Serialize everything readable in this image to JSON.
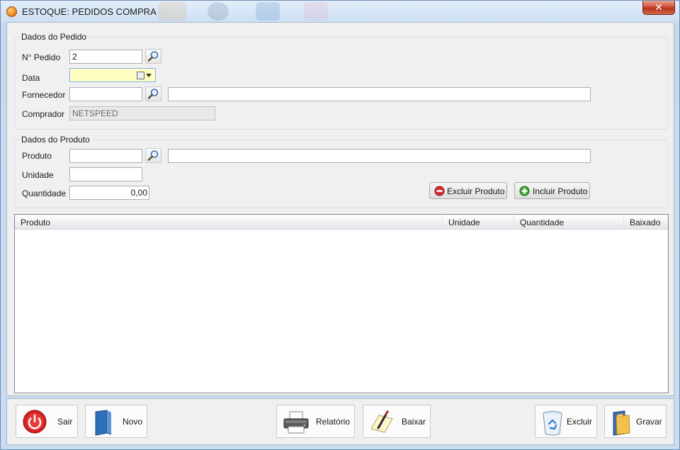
{
  "window": {
    "title": "ESTOQUE: PEDIDOS COMPRA",
    "close_glyph": "✕"
  },
  "dados_pedido": {
    "legend": "Dados do Pedido",
    "numero_label": "N° Pedido",
    "numero_value": "2",
    "data_label": "Data",
    "data_value": "",
    "fornecedor_label": "Fornecedor",
    "fornecedor_code": "",
    "fornecedor_name": "",
    "comprador_label": "Comprador",
    "comprador_value": "NETSPEED"
  },
  "dados_produto": {
    "legend": "Dados do Produto",
    "produto_label": "Produto",
    "produto_code": "",
    "produto_name": "",
    "unidade_label": "Unidade",
    "unidade_value": "",
    "quantidade_label": "Quantidade",
    "quantidade_value": "0,00",
    "excluir_produto": "Excluir Produto",
    "incluir_produto": "Incluir Produto"
  },
  "grid": {
    "columns": [
      "Produto",
      "Unidade",
      "Quantidade",
      "Baixado"
    ],
    "rows": []
  },
  "toolbar": {
    "sair": "Sair",
    "novo": "Novo",
    "relatorio": "Relatório",
    "baixar": "Baixar",
    "excluir": "Excluir",
    "gravar": "Gravar"
  },
  "icons": {
    "app": "app-logo-icon",
    "search": "magnifier-icon",
    "calendar": "calendar-icon",
    "excluir_produto": "minus-circle-icon",
    "incluir_produto": "plus-circle-icon",
    "sair": "power-icon",
    "novo": "book-icon",
    "relatorio": "printer-icon",
    "baixar": "pencil-paper-icon",
    "excluir": "recycle-bin-icon",
    "gravar": "folder-save-icon"
  },
  "colors": {
    "date_field_bg": "#ffffc4",
    "remove_red": "#d32b2b",
    "add_green": "#3aa832",
    "window_frame": "#c9dcf0"
  }
}
